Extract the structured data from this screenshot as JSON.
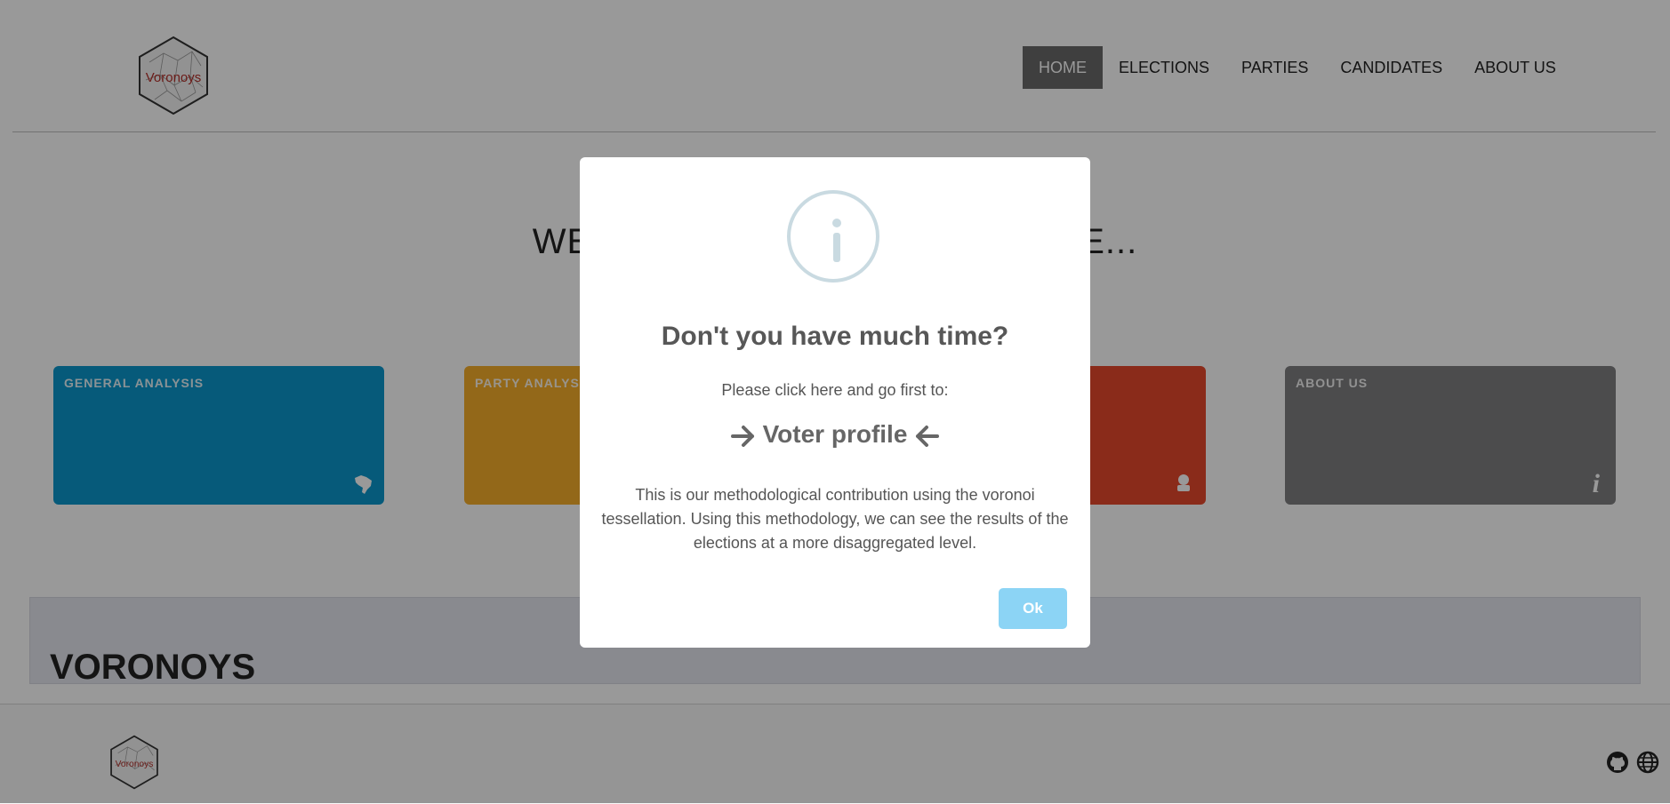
{
  "logo": {
    "text": "Voronoys"
  },
  "nav": {
    "items": [
      {
        "label": "HOME",
        "active": true
      },
      {
        "label": "ELECTIONS",
        "active": false
      },
      {
        "label": "PARTIES",
        "active": false
      },
      {
        "label": "CANDIDATES",
        "active": false
      },
      {
        "label": "ABOUT US",
        "active": false
      }
    ]
  },
  "hero": {
    "visible_left": "WE",
    "visible_right": "E..."
  },
  "cards": [
    {
      "title": "GENERAL ANALYSIS",
      "icon": "brazil-map-icon",
      "color": "#0a97cb"
    },
    {
      "title": "PARTY ANALYSIS",
      "icon": "",
      "color": "#f6ae2b"
    },
    {
      "title": "",
      "icon": "candidate-icon",
      "color": "#e6492c"
    },
    {
      "title": "ABOUT US",
      "icon": "info-icon",
      "color": "#7f7f81"
    }
  ],
  "about_section": {
    "title": "VORONOYS"
  },
  "footer": {
    "icons": [
      "github-icon",
      "globe-icon"
    ]
  },
  "modal": {
    "icon": "info-circle-icon",
    "title": "Don't you have much time?",
    "intro": "Please click here and go first to:",
    "link_label": "Voter profile",
    "body": "This is our methodological contribution using the voronoi tessellation. Using this methodology, we can see the results of the elections at a more disaggregated level.",
    "ok_label": "Ok",
    "ok_color": "#8cd4f5"
  }
}
